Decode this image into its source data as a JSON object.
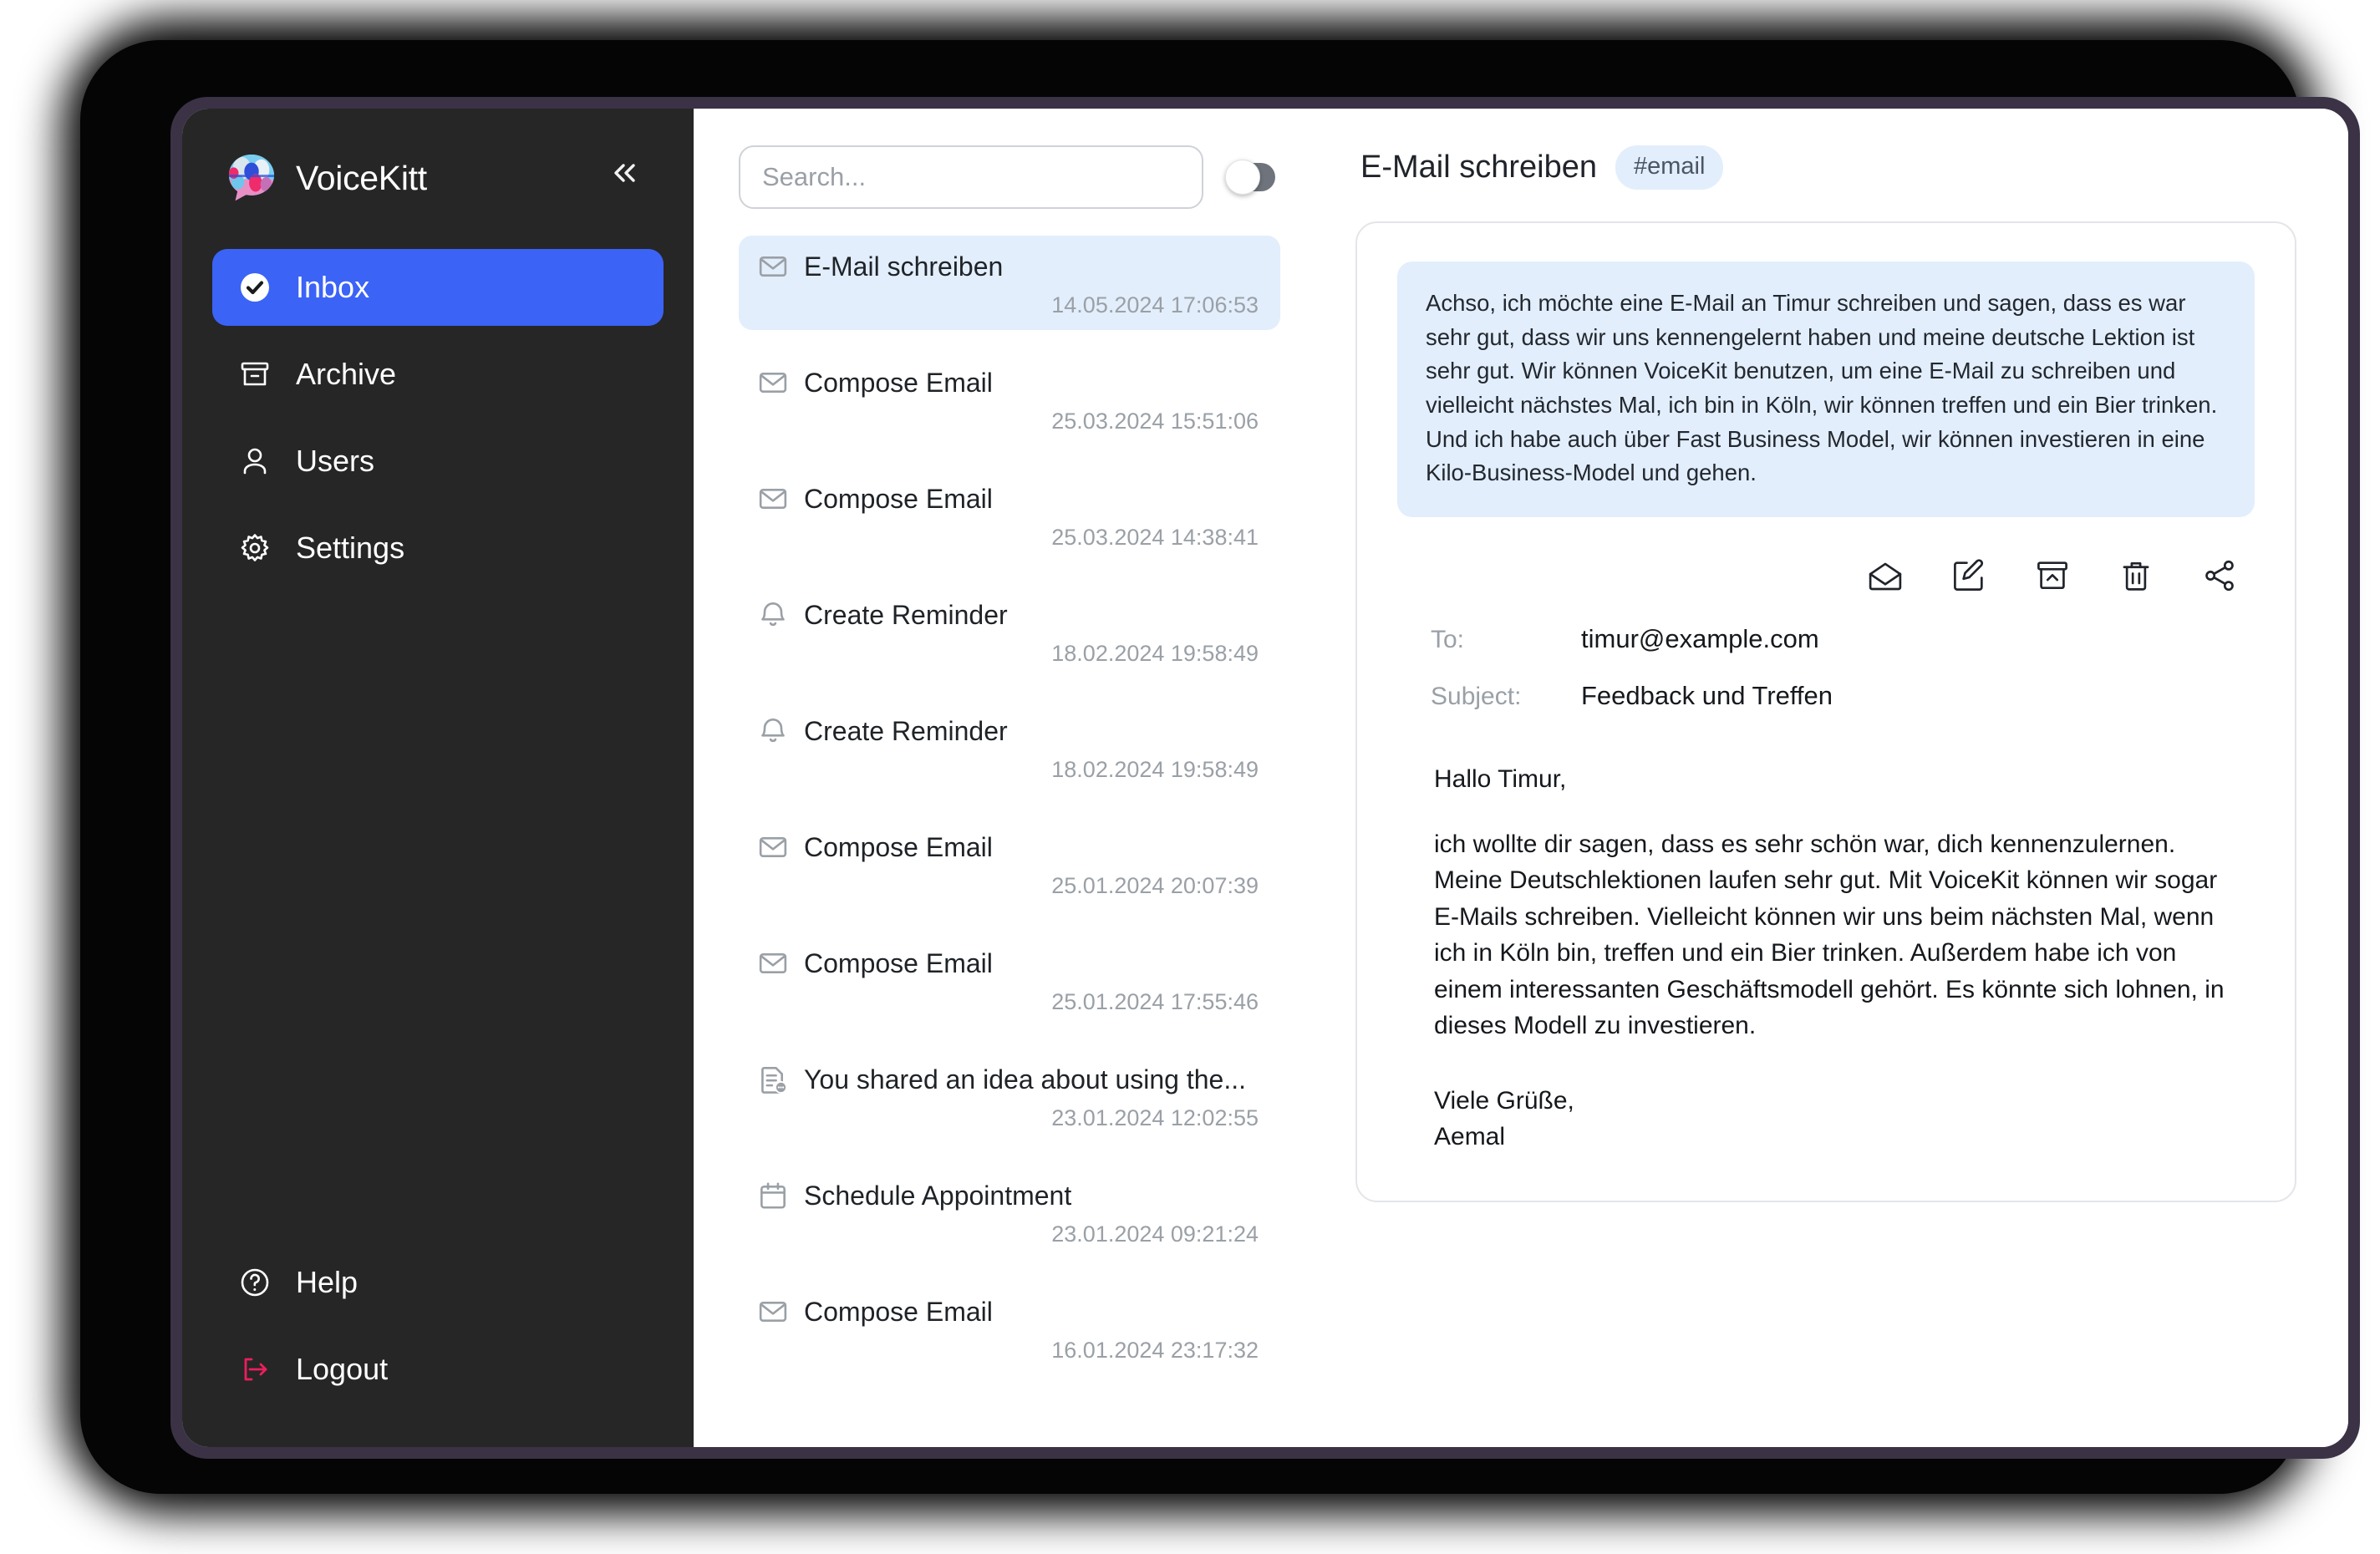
{
  "app": {
    "brand_name": "VoiceKitt",
    "logo_icon": "speech-bubble-logo",
    "collapse_icon": "chevrons-left-icon"
  },
  "colors": {
    "accent_blue": "#3b63f6",
    "sidebar_bg": "#262626",
    "selection_blue": "#e2eefc",
    "logout_pink": "#ec1e5e",
    "bezel_purple": "#3b3246"
  },
  "sidebar": {
    "items": [
      {
        "label": "Inbox",
        "icon": "check-circle-icon",
        "active": true
      },
      {
        "label": "Archive",
        "icon": "archive-icon",
        "active": false
      },
      {
        "label": "Users",
        "icon": "user-icon",
        "active": false
      },
      {
        "label": "Settings",
        "icon": "gear-icon",
        "active": false
      }
    ],
    "bottom_items": [
      {
        "label": "Help",
        "icon": "question-circle-icon"
      },
      {
        "label": "Logout",
        "icon": "logout-arrow-icon"
      }
    ]
  },
  "search": {
    "placeholder": "Search...",
    "value": "",
    "toggle_on": false
  },
  "message_list": [
    {
      "title": "E-Mail schreiben",
      "time": "14.05.2024 17:06:53",
      "icon": "envelope-icon",
      "selected": true
    },
    {
      "title": "Compose Email",
      "time": "25.03.2024 15:51:06",
      "icon": "envelope-icon",
      "selected": false
    },
    {
      "title": "Compose Email",
      "time": "25.03.2024 14:38:41",
      "icon": "envelope-icon",
      "selected": false
    },
    {
      "title": "Create Reminder",
      "time": "18.02.2024 19:58:49",
      "icon": "bell-icon",
      "selected": false
    },
    {
      "title": "Create Reminder",
      "time": "18.02.2024 19:58:49",
      "icon": "bell-icon",
      "selected": false
    },
    {
      "title": "Compose Email",
      "time": "25.01.2024 20:07:39",
      "icon": "envelope-icon",
      "selected": false
    },
    {
      "title": "Compose Email",
      "time": "25.01.2024 17:55:46",
      "icon": "envelope-icon",
      "selected": false
    },
    {
      "title": "You shared an idea about using the...",
      "time": "23.01.2024 12:02:55",
      "icon": "document-dots-icon",
      "selected": false
    },
    {
      "title": "Schedule Appointment",
      "time": "23.01.2024 09:21:24",
      "icon": "calendar-icon",
      "selected": false
    },
    {
      "title": "Compose Email",
      "time": "16.01.2024 23:17:32",
      "icon": "envelope-icon",
      "selected": false
    }
  ],
  "detail": {
    "title": "E-Mail schreiben",
    "tag": "#email",
    "transcript": "Achso, ich möchte eine E-Mail an Timur schreiben und sagen, dass es war sehr gut, dass wir uns kennengelernt haben und meine deutsche Lektion ist sehr gut. Wir können VoiceKit benutzen, um eine E-Mail zu schreiben und vielleicht nächstes Mal, ich bin in Köln, wir können treffen und ein Bier trinken. Und ich habe auch über Fast Business Model, wir können investieren in eine Kilo-Business-Model und gehen.",
    "actions": [
      {
        "name": "mark-read-icon",
        "label": "Mark as read"
      },
      {
        "name": "edit-icon",
        "label": "Edit"
      },
      {
        "name": "archive-icon",
        "label": "Archive"
      },
      {
        "name": "trash-icon",
        "label": "Delete"
      },
      {
        "name": "share-icon",
        "label": "Share"
      }
    ],
    "to_label": "To:",
    "to_value": "timur@example.com",
    "subject_label": "Subject:",
    "subject_value": "Feedback und Treffen",
    "body_greeting": "Hallo Timur,",
    "body_paragraph": "ich wollte dir sagen, dass es sehr schön war, dich kennenzulernen. Meine Deutschlektionen laufen sehr gut. Mit VoiceKit können wir sogar E-Mails schreiben. Vielleicht können wir uns beim nächsten Mal, wenn ich in Köln bin, treffen und ein Bier trinken. Außerdem habe ich von einem interessanten Geschäftsmodell gehört. Es könnte sich lohnen, in dieses Modell zu investieren.",
    "body_signature": "Viele Grüße,\nAemal"
  }
}
